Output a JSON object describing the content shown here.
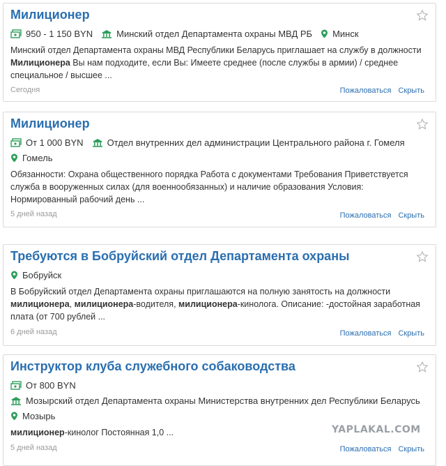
{
  "colors": {
    "link": "#2a6fb0",
    "icon_green": "#2e9e5b",
    "muted": "#9a9a9a"
  },
  "actions": {
    "complain": "Пожаловаться",
    "hide": "Скрыть"
  },
  "cards": [
    {
      "title": "Милиционер",
      "salary": "950 - 1 150 BYN",
      "employer": "Минский отдел Департамента охраны МВД РБ",
      "location": "Минск",
      "desc_parts": [
        "Минский отдел Департамента охраны МВД Республики Беларусь приглашает на службу в должности ",
        "Милиционера",
        " Вы нам подходите, если Вы: Имеете среднее (после службы в армии) / среднее специальное / высшее ..."
      ],
      "date": "Сегодня"
    },
    {
      "title": "Милиционер",
      "salary": "От 1 000 BYN",
      "employer": "Отдел внутренних дел администрации Центрального района г. Гомеля",
      "location": "Гомель",
      "desc_parts": [
        "Обязанности: Охрана общественного порядка Работа с документами Требования Приветствуется служба в вооруженных силах (для военнообязанных) и наличие образования Условия: Нормированный рабочий день ..."
      ],
      "date": "5 дней назад"
    },
    {
      "title": "Требуются в Бобруйский отдел Департамента охраны",
      "location": "Бобруйск",
      "desc_parts": [
        "В Бобруйский отдел Департамента охраны приглашаются на полную занятость на должности ",
        "милиционера",
        ", ",
        "милиционера",
        "-водителя, ",
        "милиционера",
        "-кинолога. Описание: -достойная заработная плата (от 700 рублей ..."
      ],
      "date": "6 дней назад"
    },
    {
      "title": "Инструктор клуба служебного собаководства",
      "salary": "От 800 BYN",
      "employer": "Мозырский отдел Департамента охраны Министерства внутренних дел Республики Беларусь",
      "location": "Мозырь",
      "desc_parts": [
        "милиционер",
        "-кинолог Постоянная 1,0 ..."
      ],
      "date": "5 дней назад"
    }
  ],
  "watermark": "YAPLAKAL.COM"
}
